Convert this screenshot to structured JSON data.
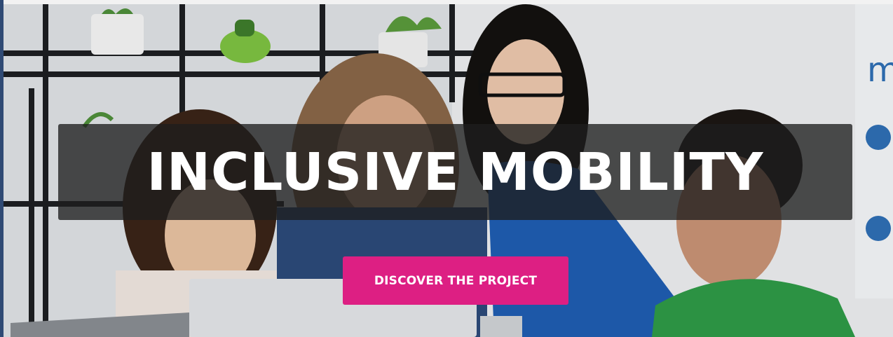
{
  "hero": {
    "title": "INCLUSIVE MOBILITY",
    "cta_label": "DISCOVER THE PROJECT",
    "background_image": "team-of-four-people-looking-at-laptop-photo"
  },
  "colors": {
    "cta_background": "#dd1f83",
    "banner_overlay": "rgba(30,30,30,0.78)",
    "title_text": "#ffffff",
    "left_edge": "#2f4a74"
  }
}
